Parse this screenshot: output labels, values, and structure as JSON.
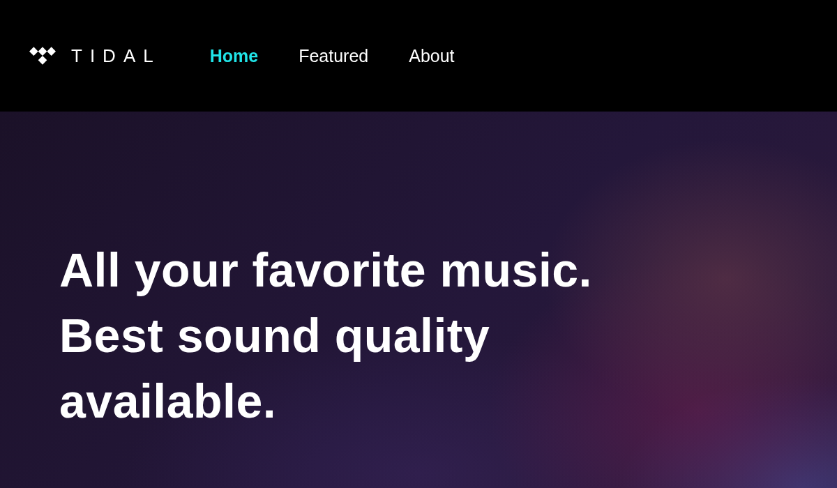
{
  "brand": {
    "name": "TIDAL"
  },
  "nav": [
    {
      "label": "Home",
      "selected": true
    },
    {
      "label": "Featured",
      "selected": false
    },
    {
      "label": "About",
      "selected": false
    }
  ],
  "hero": {
    "headline_lines": [
      "All your favorite music.",
      "Best sound quality",
      "available."
    ]
  }
}
